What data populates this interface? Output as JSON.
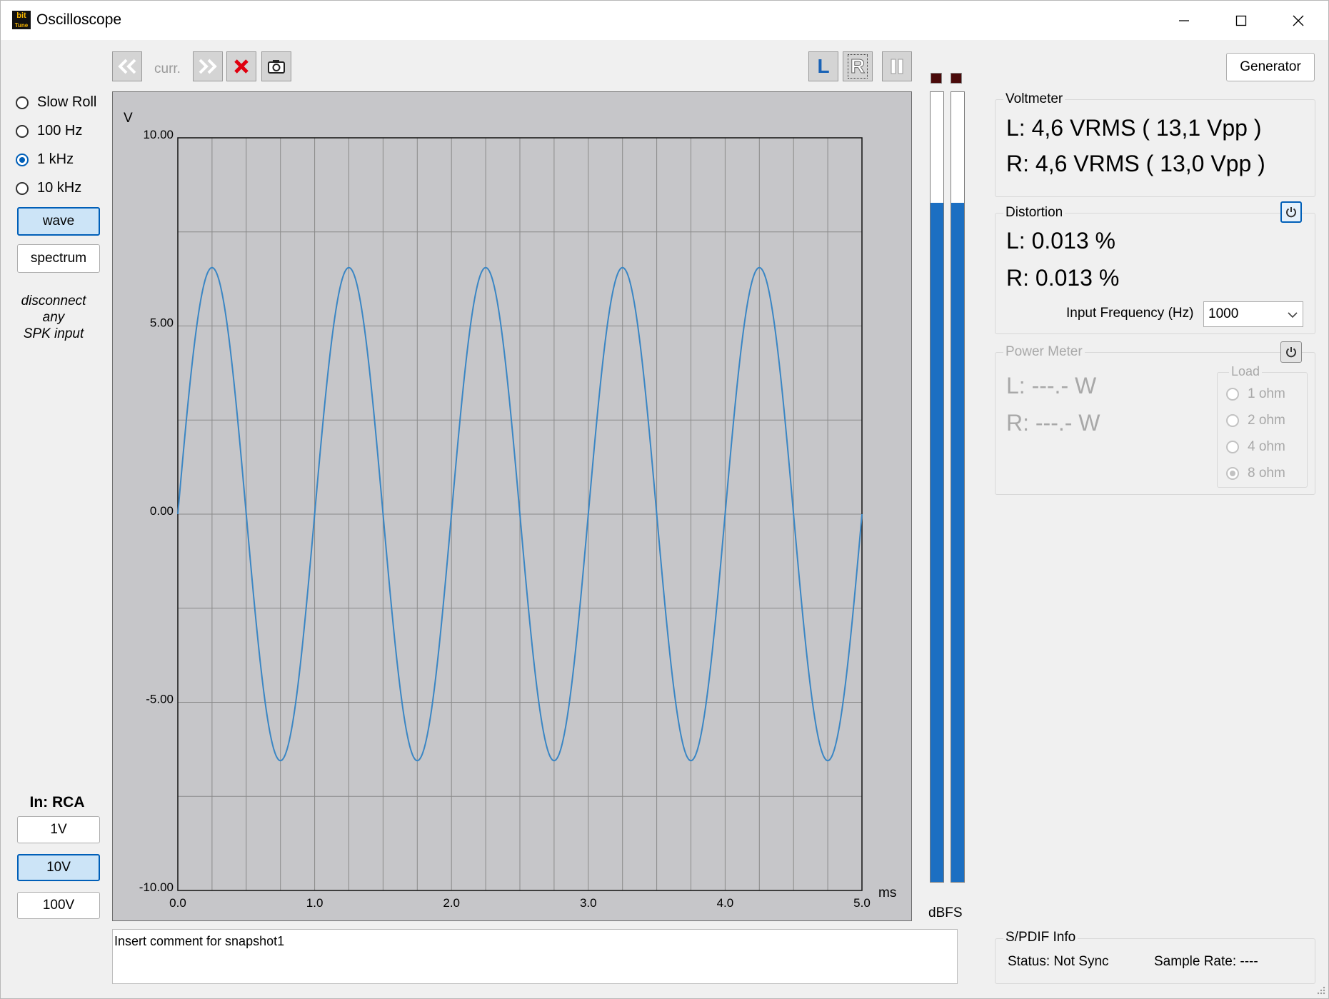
{
  "window": {
    "title": "Oscilloscope",
    "icon_text": "bit",
    "icon_subtext": "Tune"
  },
  "left_panel": {
    "rates": [
      {
        "label": "Slow Roll",
        "selected": false
      },
      {
        "label": "100 Hz",
        "selected": false
      },
      {
        "label": "1 kHz",
        "selected": true
      },
      {
        "label": "10 kHz",
        "selected": false
      }
    ],
    "wave_label": "wave",
    "spectrum_label": "spectrum",
    "hint_lines": [
      "disconnect",
      "any",
      "SPK input"
    ],
    "input_label": "In: RCA",
    "ranges": [
      {
        "label": "1V",
        "selected": false
      },
      {
        "label": "10V",
        "selected": true
      },
      {
        "label": "100V",
        "selected": false
      }
    ]
  },
  "toolbar": {
    "curr_label": "curr.",
    "left_channel_label": "L",
    "right_channel_label": "R"
  },
  "chart_data": {
    "type": "line",
    "title": "",
    "xlabel": "ms",
    "ylabel": "V",
    "xlim": [
      0,
      5
    ],
    "ylim": [
      -10,
      10
    ],
    "x_ticks": [
      "0.0",
      "1.0",
      "2.0",
      "3.0",
      "4.0",
      "5.0"
    ],
    "y_ticks": [
      "10.00",
      "5.00",
      "0.00",
      "-5.00",
      "-10.00"
    ],
    "grid": true,
    "series": [
      {
        "amplitude": 6.55,
        "frequency_khz": 1.0,
        "phase_deg": 0,
        "color": "#3a86c4"
      }
    ]
  },
  "level_meter": {
    "label": "dBFS",
    "left_level": 0.86,
    "right_level": 0.86,
    "color": "#1c6fc2"
  },
  "comment": {
    "text": "Insert comment for snapshot1"
  },
  "generator_label": "Generator",
  "voltmeter": {
    "title": "Voltmeter",
    "left": "L: 4,6 VRMS ( 13,1 Vpp )",
    "right": "R: 4,6 VRMS ( 13,0 Vpp )"
  },
  "distortion": {
    "title": "Distortion",
    "left": "L: 0.013 %",
    "right": "R: 0.013 %",
    "freq_label": "Input Frequency (Hz)",
    "freq_value": "1000"
  },
  "power_meter": {
    "title": "Power Meter",
    "left": "L: ---.- W",
    "right": "R: ---.- W",
    "load_title": "Load",
    "loads": [
      {
        "label": "1 ohm",
        "selected": false
      },
      {
        "label": "2 ohm",
        "selected": false
      },
      {
        "label": "4 ohm",
        "selected": false
      },
      {
        "label": "8 ohm",
        "selected": true
      }
    ]
  },
  "spdif": {
    "title": "S/PDIF Info",
    "status": "Status: Not Sync",
    "sample_rate": "Sample Rate: ----"
  }
}
